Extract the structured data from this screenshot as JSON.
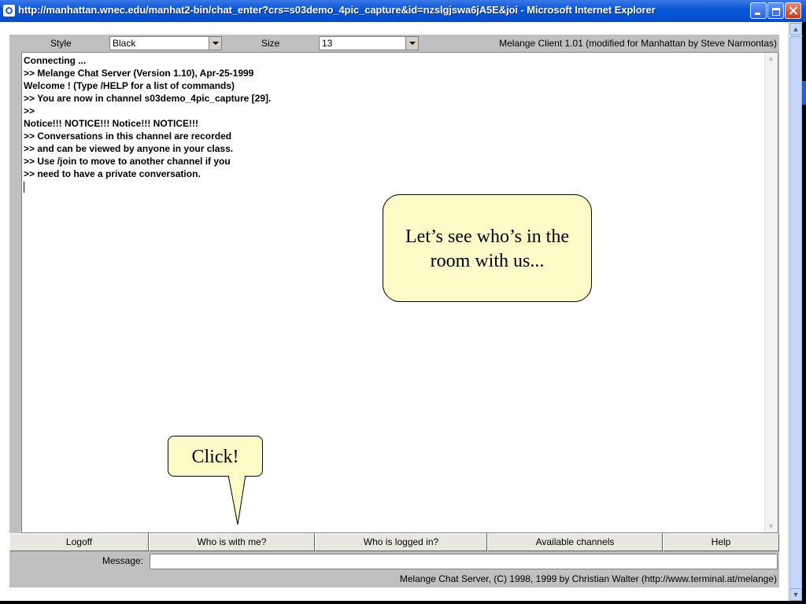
{
  "window": {
    "title": "http://manhattan.wnec.edu/manhat2-bin/chat_enter?crs=s03demo_4pic_capture&id=nzslgjswa6jA5E&joi - Microsoft Internet Explorer"
  },
  "applet": {
    "style_label": "Style",
    "style_value": "Black",
    "size_label": "Size",
    "size_value": "13",
    "client_label": "Melange Client 1.01 (modified for Manhattan by Steve Narmontas)",
    "chat_lines": [
      "Connecting ...",
      ">> Melange Chat Server (Version 1.10), Apr-25-1999",
      "Welcome ! (Type /HELP for a list of commands)",
      ">> You are now in channel s03demo_4pic_capture [29].",
      ">>",
      "Notice!!! NOTICE!!! Notice!!! NOTICE!!!",
      ">> Conversations in this channel are recorded",
      ">> and can be viewed by anyone in your class.",
      ">> Use /join to move to another channel if you",
      ">> need to have a private conversation."
    ],
    "buttons": {
      "logoff": "Logoff",
      "who_with_me": "Who is with me?",
      "who_logged_in": "Who is logged in?",
      "channels": "Available channels",
      "help": "Help"
    },
    "message_label": "Message:",
    "message_value": "",
    "footer": "Melange Chat Server, (C) 1998, 1999 by Christian Walter  (http://www.terminal.at/melange)"
  },
  "callouts": {
    "room": "Let’s see who’s  in the room with us...",
    "click": "Click!"
  },
  "colors": {
    "titlebar": "#0a58d8",
    "panel": "#c0c0c0",
    "callout_fill": "#fdfbc8"
  }
}
